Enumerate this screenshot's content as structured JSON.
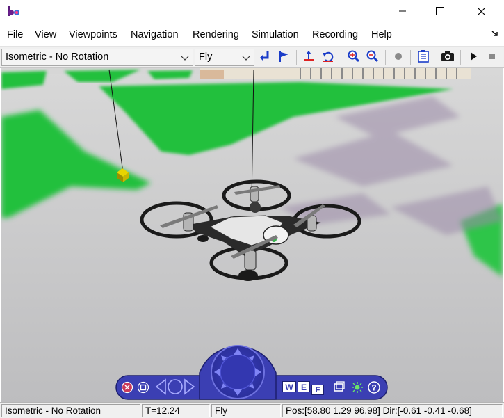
{
  "titlebar": {
    "icons": {
      "app": "vr-app-icon",
      "minimize": "minimize-icon",
      "maximize": "maximize-icon",
      "close": "close-icon"
    }
  },
  "menu": {
    "items": [
      "File",
      "View",
      "Viewpoints",
      "Navigation",
      "Rendering",
      "Simulation",
      "Recording",
      "Help"
    ],
    "corner_icon": "dock-arrow-icon"
  },
  "toolbar": {
    "viewpoint_select": {
      "value": "Isometric - No Rotation"
    },
    "navigation_mode_select": {
      "value": "Fly"
    },
    "buttons": [
      "return-to-viewpoint-icon",
      "go-to-default-viewpoint-icon",
      "straighten-up-icon",
      "undo-move-icon",
      "zoom-in-icon",
      "zoom-out-icon",
      "record-icon",
      "simulation-parameters-icon",
      "capture-frame-icon",
      "start-simulation-icon",
      "stop-simulation-icon"
    ]
  },
  "navigation_panel": {
    "buttons": [
      "close-panel-icon",
      "restore-panel-icon",
      "rotate-left-icon",
      "rotate-center-icon",
      "rotate-right-icon",
      "walk-pad-icon",
      "wireframe-icon",
      "examine-icon",
      "fly-icon",
      "camera-frame-icon",
      "headlight-icon",
      "help-icon"
    ],
    "labels": {
      "w": "W",
      "e": "E",
      "f": "F"
    }
  },
  "status": {
    "viewpoint": "Isometric - No Rotation",
    "time": "T=12.24",
    "mode": "Fly",
    "position": "Pos:[58.80 1.29 96.98] Dir:[-0.61 -0.41 -0.68]"
  },
  "colors": {
    "navpanel_blue": "#3b3fb3",
    "ground_gray": "#c7c7c9",
    "grass_green": "#23c03c",
    "toolbar_icon_blue": "#1a3cc8"
  }
}
